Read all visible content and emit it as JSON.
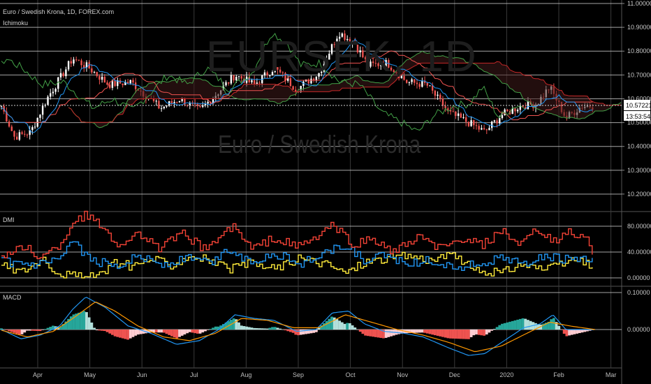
{
  "header": {
    "title": "Euro / Swedish Krona, 1D, FOREX.com",
    "indicator": "Ichimoku"
  },
  "watermark": {
    "symbol": "EURSEK, 1D",
    "name": "Euro / Swedish Krona"
  },
  "price_badge": {
    "value": "10.57221",
    "countdown": "13:53:54"
  },
  "panes": {
    "dmi_label": "DMI",
    "macd_label": "MACD"
  },
  "colors": {
    "background": "#000000",
    "grid": "#3a3a3a",
    "candle_up": "#ffffff",
    "candle_down": "#ef5350",
    "tenkan": "#2196f3",
    "kijun": "#ef5350",
    "span_a": "#43a047",
    "span_b": "#c62828",
    "chikou": "#43a047",
    "dmi_plus": "#2196f3",
    "dmi_minus": "#ff9800",
    "adx": "#f44336",
    "macd": "#2196f3",
    "signal": "#ff9800",
    "hist_pos_strong": "#26a69a",
    "hist_pos_weak": "#b2dfdb",
    "hist_neg_strong": "#ef5350",
    "hist_neg_weak": "#ffcdd2"
  },
  "chart_data": [
    {
      "type": "candlestick",
      "title": "Euro / Swedish Krona, 1D, FOREX.com",
      "y_ticks": [
        "11.00000",
        "10.90000",
        "10.80000",
        "10.70000",
        "10.60000",
        "10.50000",
        "10.40000",
        "10.30000",
        "10.20000"
      ],
      "ylim": [
        10.15,
        11.0
      ],
      "x_ticks": [
        "Apr",
        "May",
        "Jun",
        "Jul",
        "Aug",
        "Sep",
        "Oct",
        "Nov",
        "Dec",
        "2020",
        "Feb",
        "Mar"
      ],
      "last_price": 10.57221,
      "close_path": [
        {
          "x": 0,
          "y": 10.57
        },
        {
          "x": 0.2,
          "y": 10.44
        },
        {
          "x": 0.45,
          "y": 10.46
        },
        {
          "x": 0.7,
          "y": 10.6
        },
        {
          "x": 1.1,
          "y": 10.77
        },
        {
          "x": 1.35,
          "y": 10.73
        },
        {
          "x": 1.65,
          "y": 10.66
        },
        {
          "x": 2,
          "y": 10.67
        },
        {
          "x": 2.45,
          "y": 10.56
        },
        {
          "x": 2.75,
          "y": 10.6
        },
        {
          "x": 3.05,
          "y": 10.55
        },
        {
          "x": 3.35,
          "y": 10.63
        },
        {
          "x": 3.6,
          "y": 10.7
        },
        {
          "x": 3.9,
          "y": 10.66
        },
        {
          "x": 4.2,
          "y": 10.73
        },
        {
          "x": 4.55,
          "y": 10.64
        },
        {
          "x": 4.9,
          "y": 10.71
        },
        {
          "x": 5.2,
          "y": 10.88
        },
        {
          "x": 5.45,
          "y": 10.83
        },
        {
          "x": 5.65,
          "y": 10.74
        },
        {
          "x": 5.95,
          "y": 10.75
        },
        {
          "x": 6.25,
          "y": 10.67
        },
        {
          "x": 6.55,
          "y": 10.66
        },
        {
          "x": 6.9,
          "y": 10.54
        },
        {
          "x": 7.2,
          "y": 10.5
        },
        {
          "x": 7.45,
          "y": 10.46
        },
        {
          "x": 7.7,
          "y": 10.53
        },
        {
          "x": 8,
          "y": 10.57
        },
        {
          "x": 8.25,
          "y": 10.58
        },
        {
          "x": 8.45,
          "y": 10.65
        },
        {
          "x": 8.7,
          "y": 10.52
        },
        {
          "x": 8.95,
          "y": 10.57
        },
        {
          "x": 9.15,
          "y": 10.57
        }
      ]
    },
    {
      "type": "line",
      "title": "DMI",
      "y_ticks": [
        "80.00000",
        "40.00000",
        "0.00000"
      ],
      "ylim": [
        0,
        100
      ],
      "series": [
        {
          "key": "adx",
          "points": [
            {
              "x": 0,
              "y": 35
            },
            {
              "x": 0.4,
              "y": 48
            },
            {
              "x": 0.6,
              "y": 30
            },
            {
              "x": 0.9,
              "y": 52
            },
            {
              "x": 1.1,
              "y": 88
            },
            {
              "x": 1.3,
              "y": 98
            },
            {
              "x": 1.6,
              "y": 75
            },
            {
              "x": 1.85,
              "y": 45
            },
            {
              "x": 2.05,
              "y": 75
            },
            {
              "x": 2.4,
              "y": 45
            },
            {
              "x": 2.8,
              "y": 68
            },
            {
              "x": 3.1,
              "y": 45
            },
            {
              "x": 3.35,
              "y": 62
            },
            {
              "x": 3.55,
              "y": 80
            },
            {
              "x": 3.85,
              "y": 45
            },
            {
              "x": 4.2,
              "y": 62
            },
            {
              "x": 4.55,
              "y": 48
            },
            {
              "x": 4.8,
              "y": 60
            },
            {
              "x": 5.1,
              "y": 82
            },
            {
              "x": 5.4,
              "y": 52
            },
            {
              "x": 5.7,
              "y": 60
            },
            {
              "x": 6.05,
              "y": 40
            },
            {
              "x": 6.4,
              "y": 62
            },
            {
              "x": 6.8,
              "y": 45
            },
            {
              "x": 7.1,
              "y": 60
            },
            {
              "x": 7.4,
              "y": 50
            },
            {
              "x": 7.7,
              "y": 72
            },
            {
              "x": 8,
              "y": 50
            },
            {
              "x": 8.25,
              "y": 75
            },
            {
              "x": 8.5,
              "y": 55
            },
            {
              "x": 8.75,
              "y": 72
            },
            {
              "x": 9.0,
              "y": 60
            },
            {
              "x": 9.15,
              "y": 28
            }
          ]
        },
        {
          "key": "plus",
          "points": [
            {
              "x": 0,
              "y": 25
            },
            {
              "x": 0.5,
              "y": 18
            },
            {
              "x": 0.9,
              "y": 28
            },
            {
              "x": 1.1,
              "y": 55
            },
            {
              "x": 1.4,
              "y": 25
            },
            {
              "x": 1.8,
              "y": 20
            },
            {
              "x": 2.1,
              "y": 35
            },
            {
              "x": 2.5,
              "y": 20
            },
            {
              "x": 2.9,
              "y": 32
            },
            {
              "x": 3.2,
              "y": 22
            },
            {
              "x": 3.5,
              "y": 45
            },
            {
              "x": 3.8,
              "y": 25
            },
            {
              "x": 4.2,
              "y": 38
            },
            {
              "x": 4.6,
              "y": 22
            },
            {
              "x": 5.0,
              "y": 40
            },
            {
              "x": 5.3,
              "y": 50
            },
            {
              "x": 5.6,
              "y": 25
            },
            {
              "x": 5.9,
              "y": 35
            },
            {
              "x": 6.3,
              "y": 22
            },
            {
              "x": 6.6,
              "y": 28
            },
            {
              "x": 7.0,
              "y": 15
            },
            {
              "x": 7.3,
              "y": 22
            },
            {
              "x": 7.7,
              "y": 30
            },
            {
              "x": 8.0,
              "y": 22
            },
            {
              "x": 8.4,
              "y": 32
            },
            {
              "x": 8.8,
              "y": 28
            },
            {
              "x": 9.15,
              "y": 26
            }
          ]
        },
        {
          "key": "minus",
          "points": [
            {
              "x": 0,
              "y": 20
            },
            {
              "x": 0.3,
              "y": 10
            },
            {
              "x": 0.6,
              "y": 28
            },
            {
              "x": 0.9,
              "y": 8
            },
            {
              "x": 1.2,
              "y": 2
            },
            {
              "x": 1.5,
              "y": 2
            },
            {
              "x": 1.7,
              "y": 25
            },
            {
              "x": 2.0,
              "y": 18
            },
            {
              "x": 2.3,
              "y": 30
            },
            {
              "x": 2.6,
              "y": 20
            },
            {
              "x": 2.9,
              "y": 35
            },
            {
              "x": 3.2,
              "y": 28
            },
            {
              "x": 3.5,
              "y": 12
            },
            {
              "x": 3.8,
              "y": 22
            },
            {
              "x": 4.2,
              "y": 15
            },
            {
              "x": 4.6,
              "y": 30
            },
            {
              "x": 5.0,
              "y": 22
            },
            {
              "x": 5.3,
              "y": 8
            },
            {
              "x": 5.6,
              "y": 25
            },
            {
              "x": 5.9,
              "y": 30
            },
            {
              "x": 6.3,
              "y": 35
            },
            {
              "x": 6.6,
              "y": 28
            },
            {
              "x": 7.0,
              "y": 35
            },
            {
              "x": 7.3,
              "y": 10
            },
            {
              "x": 7.7,
              "y": 8
            },
            {
              "x": 8.0,
              "y": 22
            },
            {
              "x": 8.4,
              "y": 12
            },
            {
              "x": 8.8,
              "y": 28
            },
            {
              "x": 9.15,
              "y": 18
            }
          ]
        }
      ]
    },
    {
      "type": "line",
      "title": "MACD",
      "y_ticks": [
        "0.10000",
        "0.00000"
      ],
      "ylim": [
        -0.1,
        0.1
      ],
      "series": [
        {
          "key": "macd",
          "points": [
            {
              "x": 0,
              "y": 0.0
            },
            {
              "x": 0.3,
              "y": -0.025
            },
            {
              "x": 0.6,
              "y": -0.015
            },
            {
              "x": 0.9,
              "y": 0.01
            },
            {
              "x": 1.1,
              "y": 0.055
            },
            {
              "x": 1.3,
              "y": 0.088
            },
            {
              "x": 1.6,
              "y": 0.06
            },
            {
              "x": 1.95,
              "y": 0.01
            },
            {
              "x": 2.3,
              "y": -0.01
            },
            {
              "x": 2.7,
              "y": -0.04
            },
            {
              "x": 3.05,
              "y": -0.03
            },
            {
              "x": 3.35,
              "y": 0.0
            },
            {
              "x": 3.6,
              "y": 0.04
            },
            {
              "x": 3.9,
              "y": 0.03
            },
            {
              "x": 4.2,
              "y": 0.025
            },
            {
              "x": 4.55,
              "y": -0.005
            },
            {
              "x": 4.85,
              "y": 0.0
            },
            {
              "x": 5.1,
              "y": 0.045
            },
            {
              "x": 5.35,
              "y": 0.05
            },
            {
              "x": 5.6,
              "y": 0.015
            },
            {
              "x": 5.9,
              "y": -0.005
            },
            {
              "x": 6.2,
              "y": -0.01
            },
            {
              "x": 6.5,
              "y": -0.02
            },
            {
              "x": 6.9,
              "y": -0.05
            },
            {
              "x": 7.2,
              "y": -0.07
            },
            {
              "x": 7.45,
              "y": -0.065
            },
            {
              "x": 7.75,
              "y": -0.03
            },
            {
              "x": 8.05,
              "y": 0.005
            },
            {
              "x": 8.3,
              "y": 0.015
            },
            {
              "x": 8.5,
              "y": 0.04
            },
            {
              "x": 8.7,
              "y": 0.0
            },
            {
              "x": 8.95,
              "y": 0.0
            },
            {
              "x": 9.15,
              "y": 0.0
            }
          ]
        },
        {
          "key": "signal",
          "points": [
            {
              "x": 0,
              "y": -0.002
            },
            {
              "x": 0.4,
              "y": -0.02
            },
            {
              "x": 0.8,
              "y": -0.005
            },
            {
              "x": 1.1,
              "y": 0.03
            },
            {
              "x": 1.45,
              "y": 0.075
            },
            {
              "x": 1.75,
              "y": 0.05
            },
            {
              "x": 2.1,
              "y": 0.01
            },
            {
              "x": 2.5,
              "y": -0.02
            },
            {
              "x": 2.9,
              "y": -0.03
            },
            {
              "x": 3.3,
              "y": -0.01
            },
            {
              "x": 3.7,
              "y": 0.03
            },
            {
              "x": 4.1,
              "y": 0.025
            },
            {
              "x": 4.5,
              "y": 0.005
            },
            {
              "x": 4.9,
              "y": 0.005
            },
            {
              "x": 5.3,
              "y": 0.04
            },
            {
              "x": 5.7,
              "y": 0.02
            },
            {
              "x": 6.1,
              "y": 0.0
            },
            {
              "x": 6.5,
              "y": -0.015
            },
            {
              "x": 6.9,
              "y": -0.035
            },
            {
              "x": 7.3,
              "y": -0.06
            },
            {
              "x": 7.7,
              "y": -0.045
            },
            {
              "x": 8.1,
              "y": -0.01
            },
            {
              "x": 8.45,
              "y": 0.02
            },
            {
              "x": 8.75,
              "y": 0.01
            },
            {
              "x": 9.15,
              "y": 0.0
            }
          ]
        }
      ]
    }
  ]
}
